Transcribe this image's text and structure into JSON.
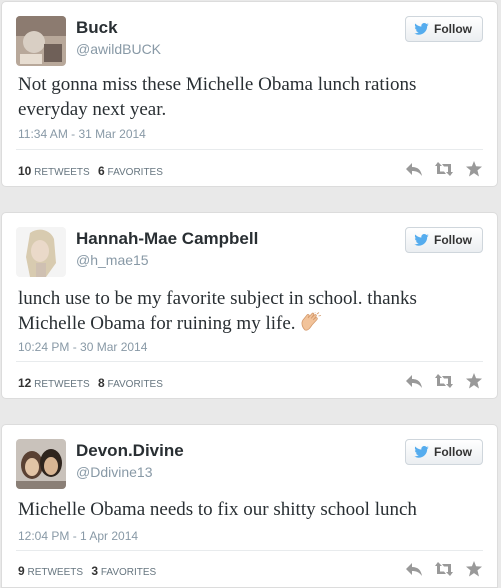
{
  "colors": {
    "follow_bird": "#55acee",
    "action_icon": "#999999"
  },
  "tweets": [
    {
      "name": "Buck",
      "handle": "@awildBUCK",
      "follow_label": "Follow",
      "text": "Not gonna miss these Michelle Obama lunch rations everyday next year.",
      "time": "11:34 AM - 31 Mar 2014",
      "retweets": "10",
      "retweets_label": "RETWEETS",
      "favorites": "6",
      "favorites_label": "FAVORITES"
    },
    {
      "name": "Hannah-Mae Campbell",
      "handle": "@h_mae15",
      "follow_label": "Follow",
      "text": "lunch use to be my favorite subject in school. thanks Michelle Obama for ruining my life.",
      "emoji": "clapping-hands-emoji",
      "time": "10:24 PM - 30 Mar 2014",
      "retweets": "12",
      "retweets_label": "RETWEETS",
      "favorites": "8",
      "favorites_label": "FAVORITES"
    },
    {
      "name": "Devon.Divine",
      "handle": "@Ddivine13",
      "follow_label": "Follow",
      "text": "Michelle Obama needs to fix our shitty school lunch",
      "time": "12:04 PM - 1 Apr 2014",
      "retweets": "9",
      "retweets_label": "RETWEETS",
      "favorites": "3",
      "favorites_label": "FAVORITES"
    }
  ],
  "icons": {
    "follow": "twitter-bird-icon",
    "reply": "reply-icon",
    "retweet": "retweet-icon",
    "favorite": "star-icon"
  }
}
